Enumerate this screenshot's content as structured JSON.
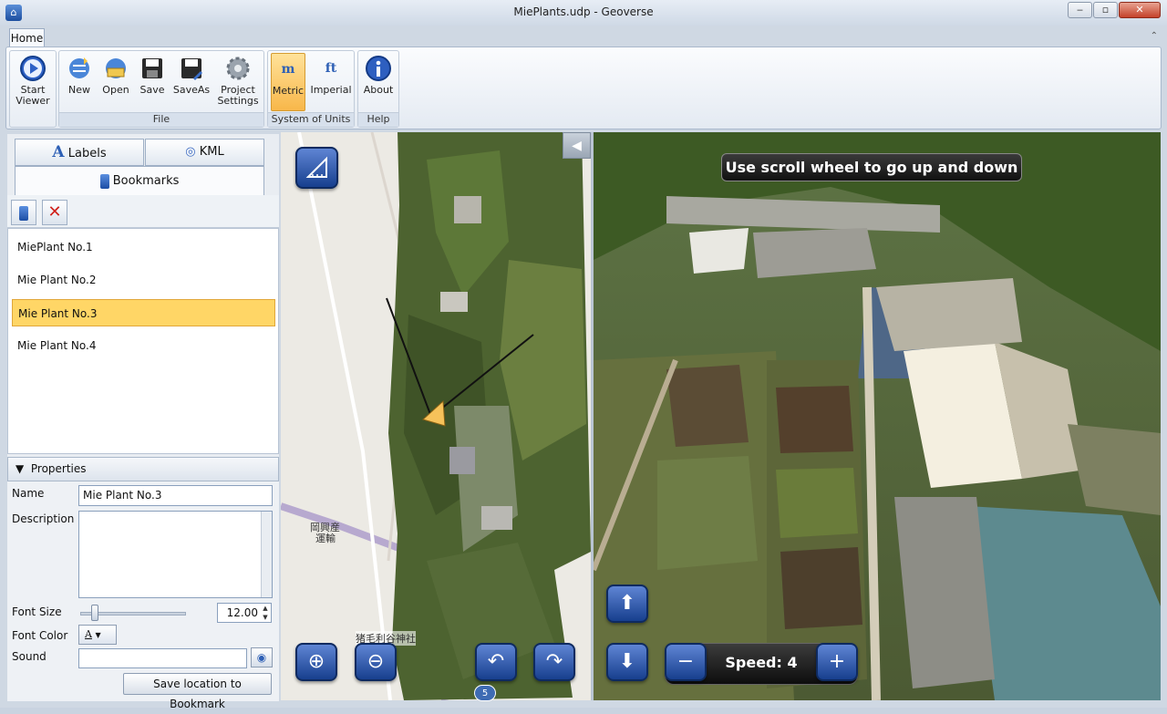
{
  "window": {
    "title": "MiePlants.udp - Geoverse",
    "min": "‒",
    "max": "▫",
    "close": "✕"
  },
  "ribbon": {
    "tab": "Home",
    "start_viewer": "Start Viewer",
    "file": {
      "new": "New",
      "open": "Open",
      "save": "Save",
      "saveas": "SaveAs",
      "settings": "Project Settings",
      "label": "File"
    },
    "units": {
      "metric": "Metric",
      "imperial": "Imperial",
      "label": "System of Units",
      "metric_glyph": "m",
      "imperial_glyph": "ft"
    },
    "help": {
      "about": "About",
      "label": "Help"
    }
  },
  "panel": {
    "tabs": {
      "labels": "Labels",
      "kml": "KML",
      "bookmarks": "Bookmarks"
    },
    "bookmarks": [
      "MiePlant No.1",
      "Mie Plant No.2",
      "Mie Plant No.3",
      "Mie Plant No.4"
    ],
    "selected_index": 2,
    "properties": {
      "header": "Properties",
      "name_label": "Name",
      "name_value": "Mie Plant No.3",
      "description_label": "Description",
      "description_value": "",
      "font_size_label": "Font Size",
      "font_size_value": "12.00",
      "font_size_slider": 0.15,
      "font_color_label": "Font Color",
      "font_color_glyph": "A",
      "sound_label": "Sound",
      "sound_value": "",
      "save_button": "Save location to Bookmark"
    }
  },
  "map": {
    "labels": [
      "岡興産",
      "運輸",
      "猪毛利谷神社"
    ],
    "badge": "5",
    "nav_left": "◀",
    "nav_right": "▶"
  },
  "view3d": {
    "hint": "Use scroll wheel to go up and down",
    "speed_label": "Speed: 4"
  }
}
